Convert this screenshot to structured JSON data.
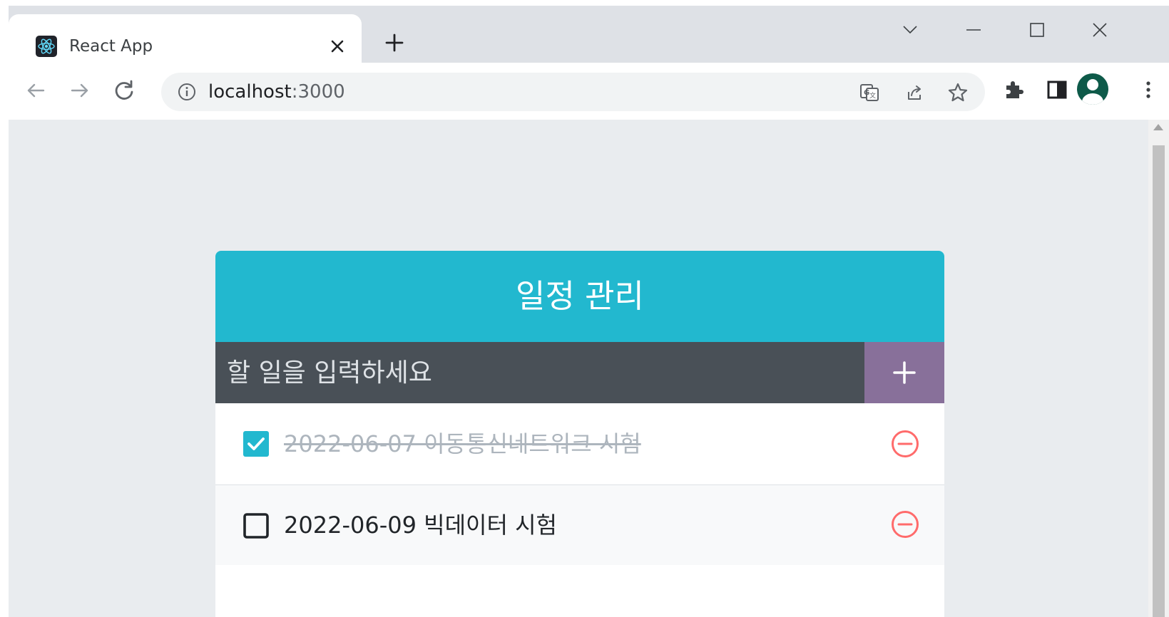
{
  "browser": {
    "tab_title": "React App",
    "url_host": "localhost",
    "url_port": ":3000"
  },
  "app": {
    "title": "일정 관리",
    "input_placeholder": "할 일을 입력하세요",
    "add_button_icon": "plus-icon"
  },
  "todos": [
    {
      "text": "2022-06-07 이동통신네트워크 시험",
      "checked": true
    },
    {
      "text": "2022-06-09 빅데이터 시험",
      "checked": false
    }
  ],
  "colors": {
    "header": "#22b8cf",
    "input_bar": "#495057",
    "add_button": "#88709a",
    "remove": "#ff6b6b",
    "checked_box": "#22b8cf"
  }
}
